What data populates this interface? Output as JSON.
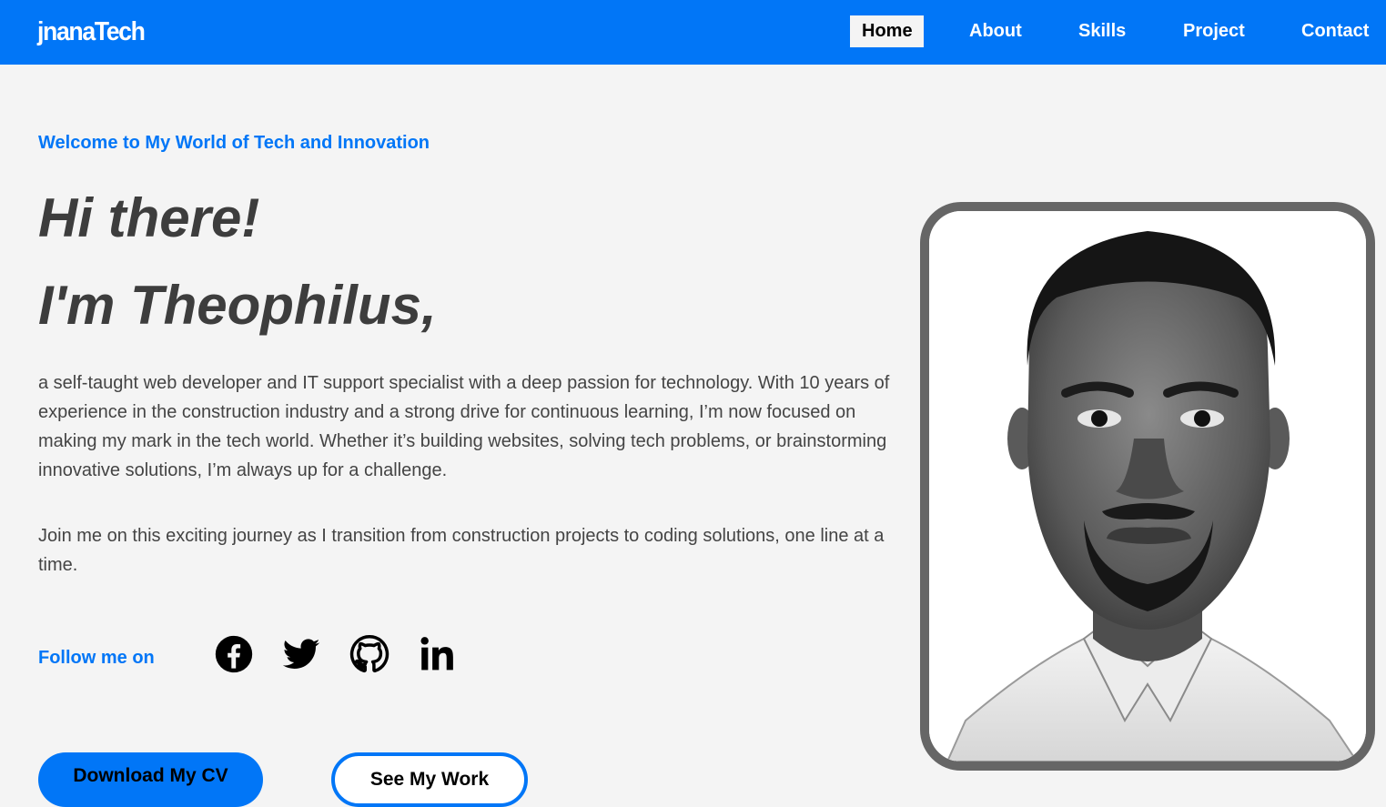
{
  "brand": {
    "logo_text": "jnanaTech"
  },
  "nav": {
    "items": [
      {
        "label": "Home",
        "active": true
      },
      {
        "label": "About",
        "active": false
      },
      {
        "label": "Skills",
        "active": false
      },
      {
        "label": "Project",
        "active": false
      },
      {
        "label": "Contact",
        "active": false
      }
    ]
  },
  "hero": {
    "welcome": "Welcome to My World of Tech and Innovation",
    "greeting": "Hi there!",
    "name_line": "I'm Theophilus,",
    "paragraph_1": "a self-taught web developer and IT support specialist with a deep passion for technology. With 10 years of experience in the construction industry and a strong drive for continuous learning, I’m now focused on making my mark in the tech world. Whether it’s building websites, solving tech problems, or brainstorming innovative solutions, I’m always up for a challenge.",
    "paragraph_2": "Join me on this exciting journey as I transition from construction projects to coding solutions, one line at a time."
  },
  "social": {
    "label": "Follow me on",
    "icons": [
      "facebook-icon",
      "twitter-icon",
      "github-icon",
      "linkedin-icon"
    ]
  },
  "buttons": {
    "download_cv": "Download My CV",
    "see_work": "See My Work"
  },
  "profile_photo": {
    "style": "black-and-white portrait"
  },
  "colors": {
    "accent": "#0176f7",
    "background": "#f4f4f4",
    "heading": "#3d3d3d",
    "body_text": "#444444",
    "frame": "#666666"
  }
}
